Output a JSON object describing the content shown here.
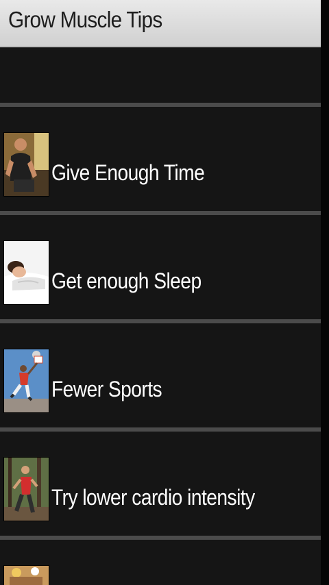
{
  "header": {
    "title": "Grow Muscle Tips"
  },
  "list": {
    "items": [
      {
        "label": "Give Enough Time"
      },
      {
        "label": "Get enough Sleep"
      },
      {
        "label": "Fewer Sports"
      },
      {
        "label": "Try lower cardio intensity"
      },
      {
        "label": ""
      }
    ]
  }
}
